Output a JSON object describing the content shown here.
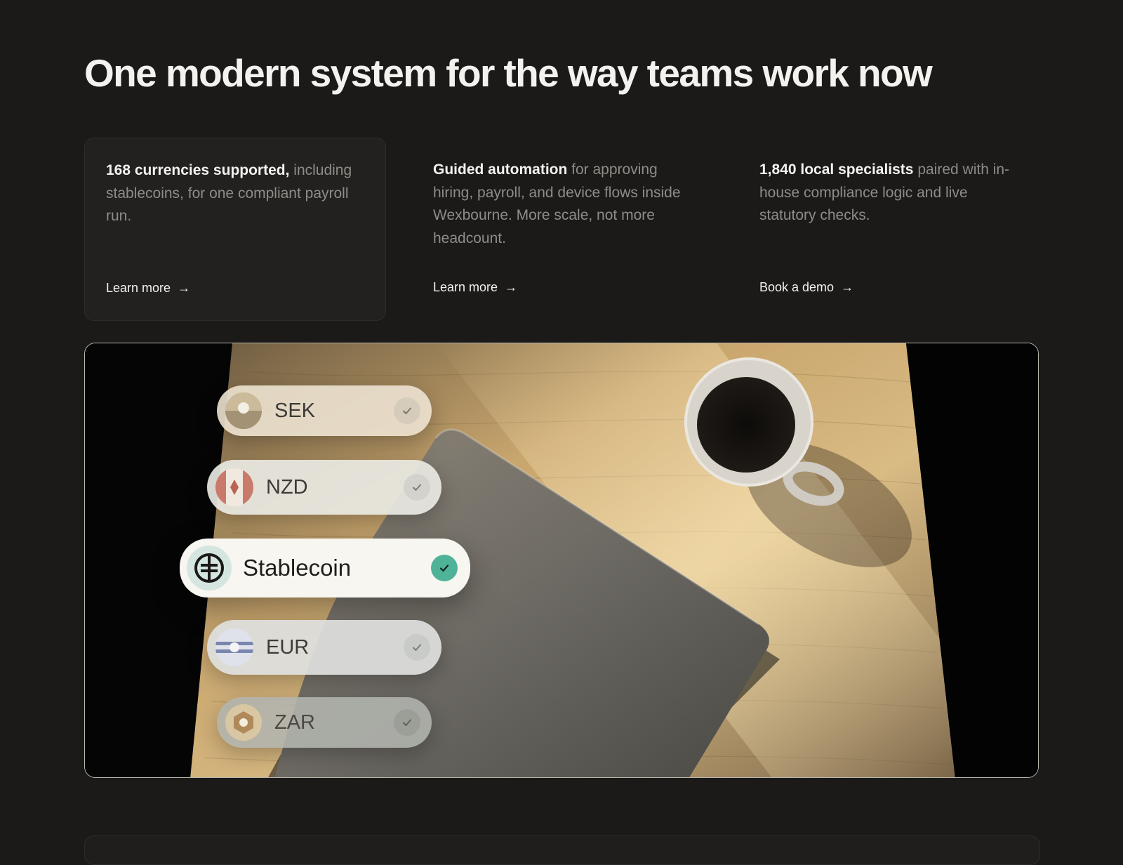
{
  "headline": "One modern system for the way teams work now",
  "features": [
    {
      "bold": "168 currencies supported,",
      "text": " including stablecoins, for one compliant payroll run.",
      "cta": "Learn more"
    },
    {
      "bold": "Guided automation",
      "text": " for approving hiring, payroll, and device flows inside Wexbourne. More scale, not more headcount.",
      "cta": "Learn more"
    },
    {
      "bold": "1,840 local specialists",
      "text": " paired with in-house compliance logic and live statutory checks.",
      "cta": "Book a demo"
    }
  ],
  "currencies": [
    {
      "code": "SEK",
      "selected": false
    },
    {
      "code": "NZD",
      "selected": false
    },
    {
      "code": "Stablecoin",
      "selected": true
    },
    {
      "code": "EUR",
      "selected": false
    },
    {
      "code": "ZAR",
      "selected": false
    }
  ],
  "colors": {
    "background": "#1b1a18",
    "accent_check": "#4fb39a"
  }
}
